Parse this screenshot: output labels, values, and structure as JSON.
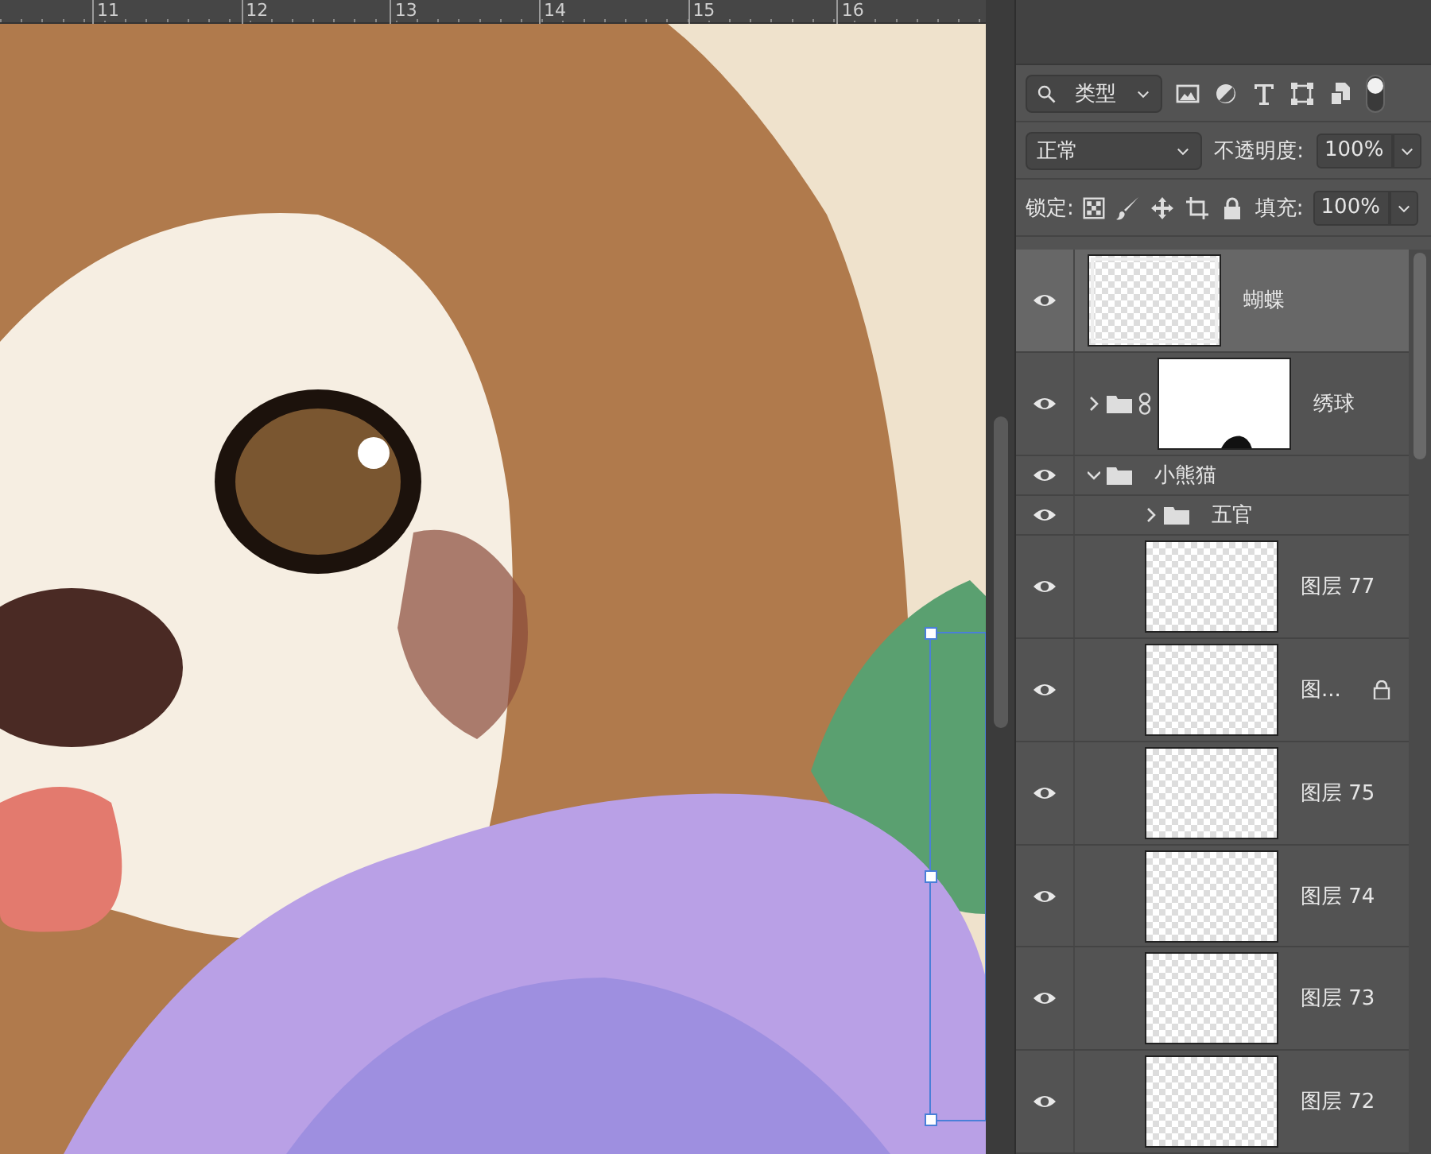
{
  "ruler": {
    "labels": [
      "11",
      "12",
      "13",
      "14",
      "15",
      "16"
    ]
  },
  "filter": {
    "label": "类型",
    "toggle_on": true
  },
  "blend": {
    "mode": "正常",
    "opacity_label": "不透明度:",
    "opacity": "100%"
  },
  "lock": {
    "label": "锁定:",
    "fill_label": "填充:",
    "fill": "100%"
  },
  "layers": [
    {
      "kind": "layer",
      "name": "蝴蝶",
      "visible": true,
      "selected": true,
      "locked": false
    },
    {
      "kind": "masked-group",
      "name": "绣球",
      "visible": true,
      "selected": false,
      "expanded": false
    },
    {
      "kind": "group",
      "name": "小熊猫",
      "visible": true,
      "selected": false,
      "expanded": true,
      "children": [
        {
          "kind": "group",
          "name": "五官",
          "visible": true,
          "selected": false,
          "expanded": false
        },
        {
          "kind": "layer",
          "name": "图层 77",
          "visible": true,
          "selected": false,
          "locked": false
        },
        {
          "kind": "layer",
          "name": "图...",
          "visible": true,
          "selected": false,
          "locked": true
        },
        {
          "kind": "layer",
          "name": "图层 75",
          "visible": true,
          "selected": false,
          "locked": false
        },
        {
          "kind": "layer",
          "name": "图层 74",
          "visible": true,
          "selected": false,
          "locked": false
        },
        {
          "kind": "layer",
          "name": "图层 73",
          "visible": true,
          "selected": false,
          "locked": false
        },
        {
          "kind": "layer",
          "name": "图层 72",
          "visible": true,
          "selected": false,
          "locked": false
        }
      ]
    }
  ]
}
